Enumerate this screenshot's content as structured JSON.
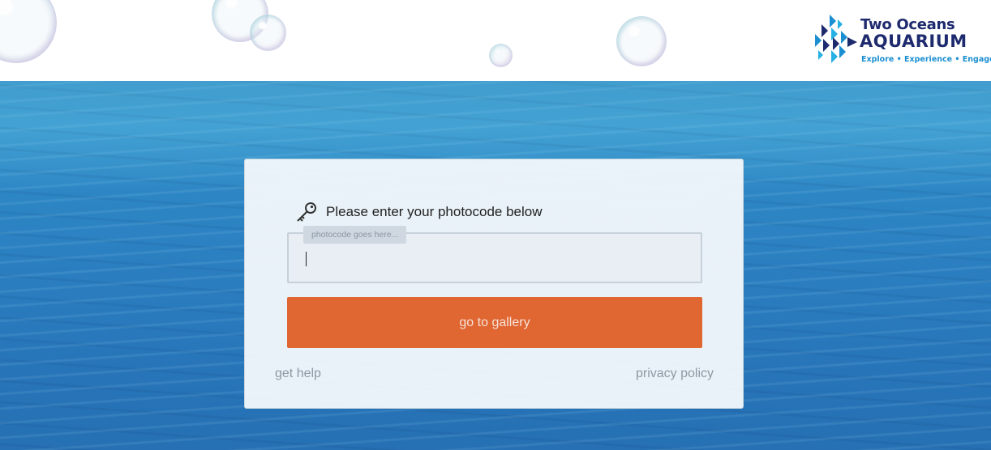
{
  "header": {
    "logo": {
      "title": "Two Oceans",
      "subtitle": "AQUARIUM",
      "tagline": "Explore • Experience • Engage"
    }
  },
  "form": {
    "prompt": "Please enter your photocode below",
    "input_value": "",
    "placeholder": "photocode goes here...",
    "submit_label": "go to gallery",
    "help_link": "get help",
    "privacy_link": "privacy policy"
  },
  "colors": {
    "accent": "#e06632",
    "brand_navy": "#1e2a6e",
    "brand_blue": "#1b8fd1"
  },
  "icons": {
    "key": "key-icon"
  }
}
